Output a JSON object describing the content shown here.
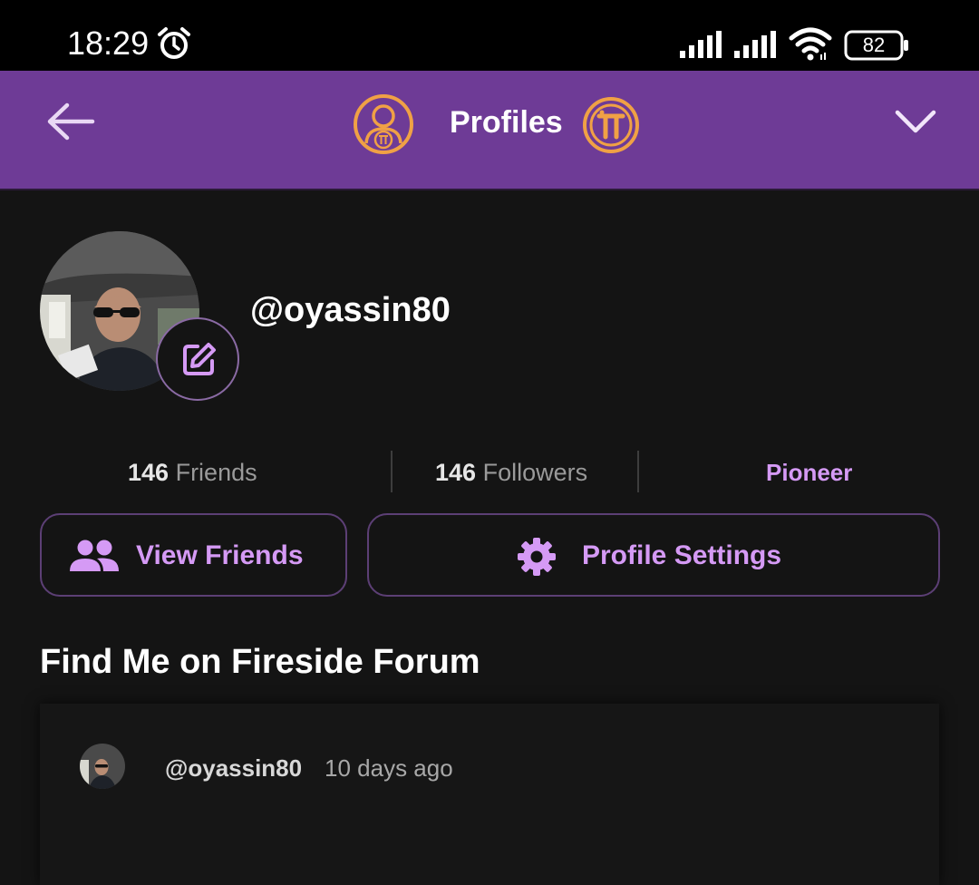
{
  "status_bar": {
    "time": "18:29",
    "battery": "82",
    "icons": [
      "alarm-icon",
      "signal-icon",
      "signal-icon",
      "wifi-icon",
      "battery-icon"
    ]
  },
  "header": {
    "title": "Profiles",
    "back_icon": "arrow-left-icon",
    "left_badge_icon": "profile-badge-icon",
    "right_badge_icon": "pi-coin-icon",
    "menu_icon": "chevron-down-icon"
  },
  "profile": {
    "username": "@oyassin80",
    "edit_icon": "edit-icon"
  },
  "stats": {
    "friends_count": "146",
    "friends_label": "Friends",
    "followers_count": "146",
    "followers_label": "Followers",
    "role": "Pioneer"
  },
  "actions": {
    "view_friends_label": "View Friends",
    "profile_settings_label": "Profile Settings"
  },
  "forum": {
    "heading": "Find Me on Fireside Forum",
    "post": {
      "username": "@oyassin80",
      "time": "10 days ago"
    }
  },
  "colors": {
    "header_bg": "#6e3b96",
    "accent": "#d59af5",
    "pi_orange": "#f0a145",
    "background": "#141414"
  }
}
